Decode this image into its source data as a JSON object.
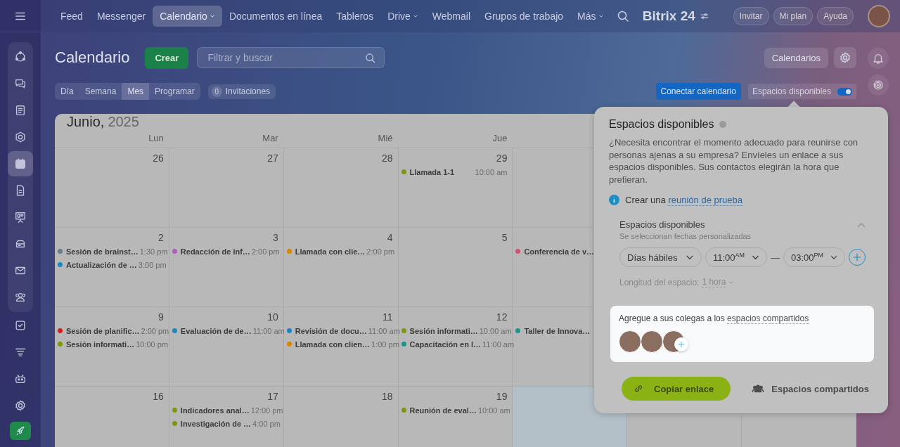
{
  "topbar": {
    "nav": [
      {
        "label": "Feed",
        "selected": false,
        "dropdown": false
      },
      {
        "label": "Messenger",
        "selected": false,
        "dropdown": false
      },
      {
        "label": "Calendario",
        "selected": true,
        "dropdown": true
      },
      {
        "label": "Documentos en línea",
        "selected": false,
        "dropdown": false
      },
      {
        "label": "Tableros",
        "selected": false,
        "dropdown": false
      },
      {
        "label": "Drive",
        "selected": false,
        "dropdown": true
      },
      {
        "label": "Webmail",
        "selected": false,
        "dropdown": false
      },
      {
        "label": "Grupos de trabajo",
        "selected": false,
        "dropdown": false
      },
      {
        "label": "Más",
        "selected": false,
        "dropdown": true
      }
    ],
    "logo": "Bitrix 24",
    "buttons": [
      "Invitar",
      "Mi plan",
      "Ayuda"
    ]
  },
  "sidebar": {
    "items": [
      {
        "selected": false
      },
      {
        "selected": false
      },
      {
        "selected": false
      },
      {
        "selected": false
      },
      {
        "selected": true
      },
      {
        "selected": false
      },
      {
        "selected": false
      },
      {
        "selected": false
      },
      {
        "selected": false
      },
      {
        "selected": false
      },
      {
        "selected": false
      },
      {
        "selected": false
      },
      {
        "selected": false
      },
      {
        "selected": false
      }
    ]
  },
  "header": {
    "title": "Calendario",
    "create_button": "Crear",
    "search": {
      "placeholder": "Filtrar y buscar"
    },
    "calendars_button": "Calendarios"
  },
  "views": [
    {
      "label": "Día",
      "selected": false
    },
    {
      "label": "Semana",
      "selected": false
    },
    {
      "label": "Mes",
      "selected": true
    },
    {
      "label": "Programar",
      "selected": false
    }
  ],
  "invitations": {
    "count": "0",
    "label": "Invitaciones"
  },
  "connect_button": "Conectar calendario",
  "slots_toggle": {
    "label": "Espacios disponibles",
    "on": true
  },
  "calendar": {
    "month": "Junio,",
    "year": "2025",
    "weekdays": [
      "Lun",
      "Mar",
      "Mié",
      "Jue"
    ],
    "weeks": [
      {
        "days": [
          {
            "day": "26",
            "today": false
          },
          {
            "day": "27",
            "today": false
          },
          {
            "day": "28",
            "today": false
          },
          {
            "day": "29",
            "today": false,
            "events": [
              {
                "title": "Llamada 1-1",
                "time": "10:00 am",
                "color": "#7a9a0a"
              }
            ]
          },
          {
            "today": false
          }
        ]
      },
      {
        "days": [
          {
            "day": "2",
            "today": false,
            "events": [
              {
                "title": "Sesión de brainst…",
                "time": "1:30 pm",
                "color": "#6b7a88"
              },
              {
                "title": "Actualización de …",
                "time": "3:00 pm",
                "color": "#1b88c4"
              }
            ]
          },
          {
            "day": "3",
            "today": false,
            "events": [
              {
                "title": "Redacción de inf…",
                "time": "2:00 pm",
                "color": "#b05cc0"
              }
            ]
          },
          {
            "day": "4",
            "today": false,
            "events": [
              {
                "title": "Llamada con clie…",
                "time": "2:00 pm",
                "color": "#d8860b"
              }
            ]
          },
          {
            "day": "5",
            "today": false
          },
          {
            "today": false,
            "events": [
              {
                "title": "Conferencia de v…",
                "color": "#d85070"
              }
            ]
          }
        ]
      },
      {
        "days": [
          {
            "day": "9",
            "today": false,
            "events": [
              {
                "title": "Sesión de planific…",
                "time": "2:00 pm",
                "color": "#d02020"
              },
              {
                "title": "Sesión informati…",
                "time": "10:00 pm",
                "color": "#7a9a0a"
              }
            ]
          },
          {
            "day": "10",
            "today": false,
            "events": [
              {
                "title": "Evaluación de de…",
                "time": "11:00 am",
                "color": "#1b88c4"
              }
            ]
          },
          {
            "day": "11",
            "today": false,
            "events": [
              {
                "title": "Revisión de docu…",
                "time": "11:00 am",
                "color": "#1b88c4"
              },
              {
                "title": "Llamada con clien…",
                "time": "1:00 pm",
                "color": "#d8860b"
              }
            ]
          },
          {
            "day": "12",
            "today": false,
            "events": [
              {
                "title": "Sesión informati…",
                "time": "10:00 am",
                "color": "#7a9a0a"
              },
              {
                "title": "Capacitación en l…",
                "time": "11:00 am",
                "color": "#12998a"
              }
            ]
          },
          {
            "today": false,
            "events": [
              {
                "title": "Taller de Innova…",
                "color": "#12998a"
              }
            ]
          }
        ]
      },
      {
        "days": [
          {
            "day": "16",
            "today": false
          },
          {
            "day": "17",
            "today": false,
            "events": [
              {
                "title": "Indicadores anal…",
                "time": "12:00 pm",
                "color": "#7a9a0a"
              },
              {
                "title": "Investigación de …",
                "time": "4:00 pm",
                "color": "#7a9a0a"
              }
            ]
          },
          {
            "day": "18",
            "today": false
          },
          {
            "day": "19",
            "today": false,
            "events": [
              {
                "title": "Reunión de eval…",
                "time": "10:00 am",
                "color": "#7a9a0a"
              }
            ]
          },
          {
            "today": true
          },
          {
            "today": false
          },
          {
            "today": false
          }
        ]
      }
    ]
  },
  "popup": {
    "title": "Espacios disponibles",
    "description": "¿Necesita encontrar el momento adecuado para reunirse con personas ajenas a su empresa? Envíeles un enlace a sus espacios disponibles. Sus contactos elegirán la hora que prefieran.",
    "test_prefix": "Crear una",
    "test_link": "reunión de prueba",
    "section": {
      "title": "Espacios disponibles",
      "subtitle": "Se seleccionan fechas personalizadas",
      "expanded": true,
      "days_select": "Días hábiles",
      "from_select": "11:00$^{AM}$",
      "separator": "—",
      "to_select": "03:00$^{PM}$",
      "length_label": "Longitud del espacio:",
      "length_value": "1 hora"
    },
    "colleagues": {
      "text": "Agregue a sus colegas a los",
      "link": "espacios compartidos"
    },
    "copy_button": "Copiar enlace",
    "shared_button": "Espacios compartidos"
  }
}
